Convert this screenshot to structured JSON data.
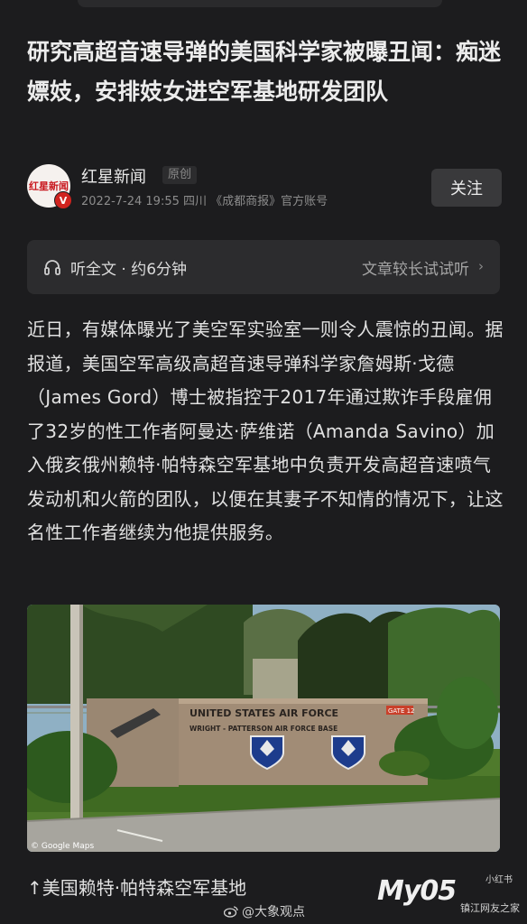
{
  "article": {
    "title": "研究高超音速导弹的美国科学家被曝丑闻：痴迷嫖妓，安排妓女进空军基地研发团队"
  },
  "author": {
    "avatar_text": "红星新闻",
    "badge": "V",
    "name": "红星新闻",
    "tag": "原创",
    "meta": "2022-7-24  19:55  四川  《成都商报》官方账号",
    "follow_label": "关注"
  },
  "listen": {
    "label": "听全文 · 约6分钟",
    "hint": "文章较长试试听",
    "chevron": "›"
  },
  "body": {
    "paragraph": "近日，有媒体曝光了美空军实验室一则令人震惊的丑闻。据报道，美国空军高级高超音速导弹科学家詹姆斯·戈德（James Gord）博士被指控于2017年通过欺诈手段雇佣了32岁的性工作者阿曼达·萨维诺（Amanda Savino）加入俄亥俄州赖特·帕特森空军基地中负责开发高超音速喷气发动机和火箭的团队，以便在其妻子不知情的情况下，让这名性工作者继续为他提供服务。"
  },
  "photo": {
    "sign_line1": "UNITED STATES AIR FORCE",
    "sign_line2": "WRIGHT - PATTERSON  AIR  FORCE  BASE",
    "gate_label": "GATE 12",
    "credit": "© Google Maps"
  },
  "caption": "↑美国赖特·帕特森空军基地",
  "watermarks": {
    "weibo_handle": "@大象观点",
    "brand": "My05",
    "small_top": "小红书",
    "small_bottom": "镇江网友之家"
  }
}
